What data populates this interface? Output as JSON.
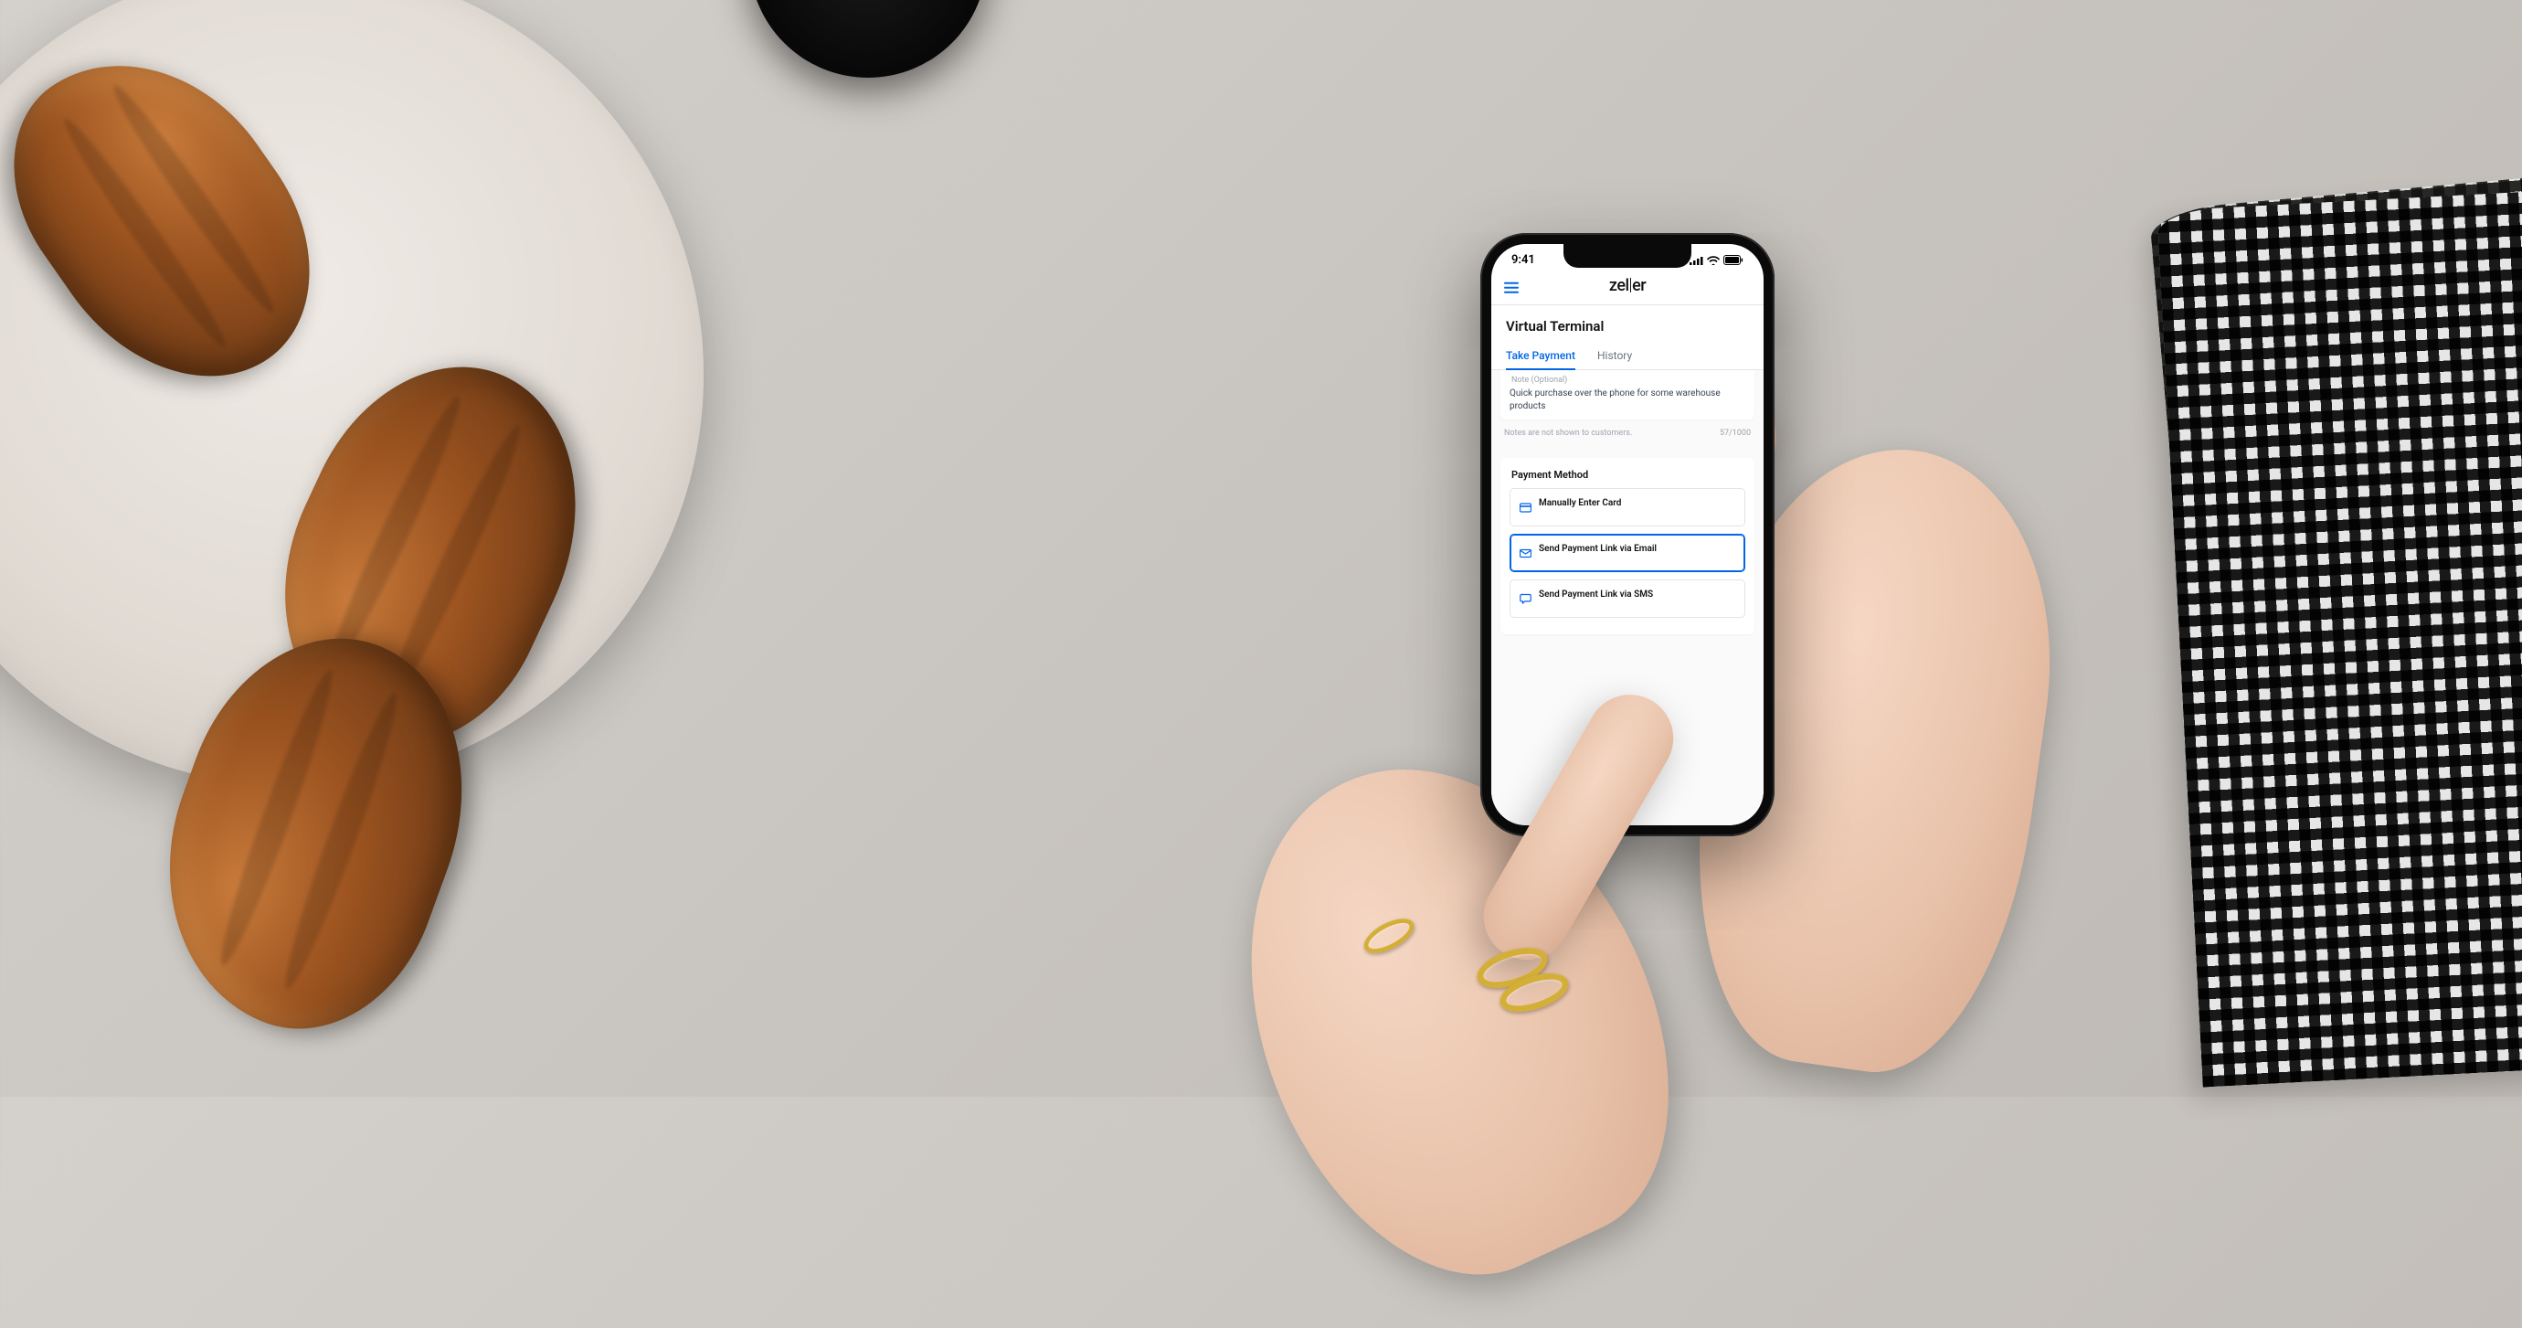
{
  "status": {
    "time": "9:41"
  },
  "header": {
    "brand_left": "zel",
    "brand_right": "er"
  },
  "page": {
    "title": "Virtual Terminal"
  },
  "tabs": [
    {
      "label": "Take Payment",
      "active": true
    },
    {
      "label": "History",
      "active": false
    }
  ],
  "note": {
    "label": "Note (Optional)",
    "value": "Quick purchase over the phone for some warehouse products",
    "hint": "Notes are not shown to customers.",
    "counter": "57/1000"
  },
  "payment": {
    "section_title": "Payment Method",
    "methods": [
      {
        "icon": "card-icon",
        "label": "Manually Enter Card",
        "selected": false
      },
      {
        "icon": "email-icon",
        "label": "Send Payment Link via Email",
        "selected": true
      },
      {
        "icon": "sms-icon",
        "label": "Send Payment Link via SMS",
        "selected": false
      }
    ]
  }
}
